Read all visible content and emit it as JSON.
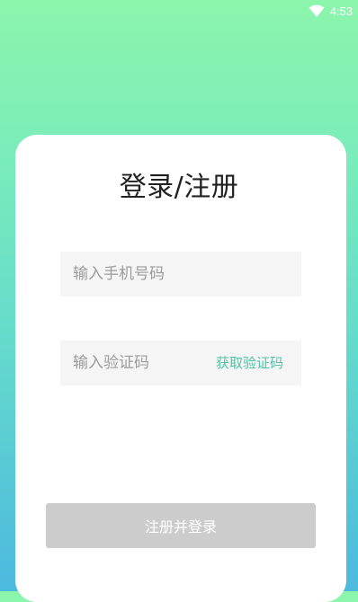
{
  "status_bar": {
    "time": "4:53",
    "wifi_icon": "wifi-icon"
  },
  "login": {
    "title": "登录/注册",
    "phone_placeholder": "输入手机号码",
    "code_placeholder": "输入验证码",
    "get_code_label": "获取验证码",
    "submit_label": "注册并登录"
  },
  "colors": {
    "gradient_top": "#8cf5ac",
    "gradient_bottom": "#4cb9df",
    "accent": "#4fc3a5",
    "submit_disabled": "#cccccc"
  }
}
